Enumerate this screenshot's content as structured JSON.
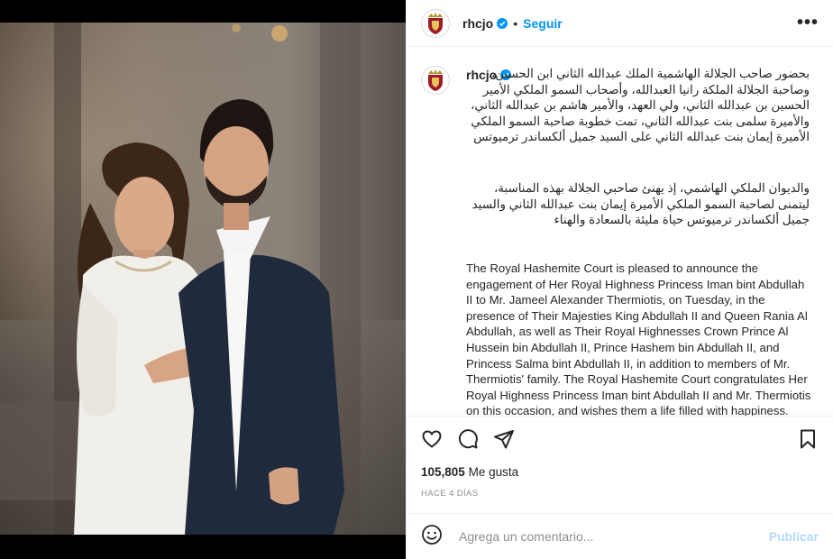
{
  "post": {
    "username": "rhcjo",
    "follow_label": "Seguir",
    "more_label": "•••",
    "caption_arabic_p1": "بحضور صاحب الجلالة الهاشمية الملك عبدالله الثاني ابن الحسين، وصاحبة الجلالة الملكة رانيا العبدالله، وأصحاب السمو الملكي الأمير الحسين بن عبدالله الثاني، ولي العهد، والأمير هاشم بن عبدالله الثاني، والأميرة سلمى بنت عبدالله الثاني، تمت خطوبة صاحبة السمو الملكي الأميرة إيمان بنت عبدالله الثاني على السيد جميل ألكساندر ترميوتس",
    "caption_arabic_p2": "والديوان الملكي الهاشمي، إذ يهنئ صاحبي الجلالة بهذه المناسبة، ليتمنى لصاحبة السمو الملكي الأميرة إيمان بنت عبدالله الثاني والسيد جميل ألكساندر ترميوتس حياة مليئة بالسعادة والهناء",
    "caption_english": "The Royal Hashemite Court is pleased to announce the engagement of Her Royal Highness Princess Iman bint Abdullah II to Mr. Jameel Alexander Thermiotis, on Tuesday, in the presence of Their Majesties King Abdullah II and Queen Rania Al Abdullah, as well as Their Royal Highnesses Crown Prince Al Hussein bin Abdullah II, Prince Hashem bin Abdullah II, and Princess Salma bint Abdullah II, in addition to members of Mr. Thermiotis' family. The Royal Hashemite Court congratulates Her Royal Highness Princess Iman bint Abdullah II and Mr. Thermiotis on this occasion, and wishes them a life filled with happiness.",
    "likes_count": "105,805",
    "likes_label": "Me gusta",
    "time_ago": "HACE 4 DÍAS"
  },
  "comment": {
    "placeholder": "Agrega un comentario...",
    "publish_label": "Publicar"
  },
  "icons": {
    "verified": "verified-badge-icon",
    "like": "heart-icon",
    "comment": "comment-bubble-icon",
    "share": "paper-plane-icon",
    "save": "bookmark-icon",
    "emoji": "emoji-icon"
  },
  "colors": {
    "accent": "#0095f6",
    "publish_disabled": "#b3dbff",
    "muted": "#8e8e8e"
  }
}
